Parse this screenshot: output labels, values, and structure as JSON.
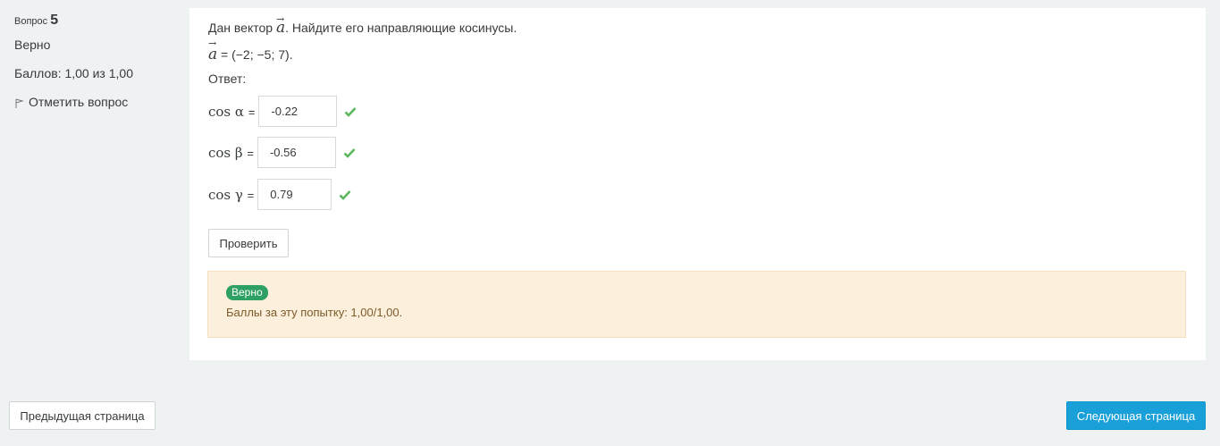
{
  "info": {
    "question_prefix": "Вопрос",
    "question_number": "5",
    "state": "Верно",
    "grade": "Баллов: 1,00 из 1,00",
    "flag_label": "Отметить вопрос"
  },
  "question": {
    "text_before": "Дан вектор",
    "vector_symbol": "a",
    "arrow_symbol": "→",
    "text_after": ". Найдите его направляющие косинусы.",
    "vector_value": " = (−2; −5; 7).",
    "answer_label": "Ответ:"
  },
  "answers": [
    {
      "label": "cos α",
      "value": "-0.22"
    },
    {
      "label": "cos β",
      "value": "-0.56"
    },
    {
      "label": "cos γ",
      "value": "0.79"
    }
  ],
  "equals": "=",
  "check_button": "Проверить",
  "feedback": {
    "badge": "Верно",
    "score": "Баллы за эту попытку: 1,00/1,00."
  },
  "nav": {
    "prev": "Предыдущая страница",
    "next": "Следующая страница"
  },
  "colors": {
    "check": "#5cb85c",
    "badge": "#2fa063",
    "next_button": "#1aa0d8",
    "feedback_bg": "#fcefdc"
  }
}
